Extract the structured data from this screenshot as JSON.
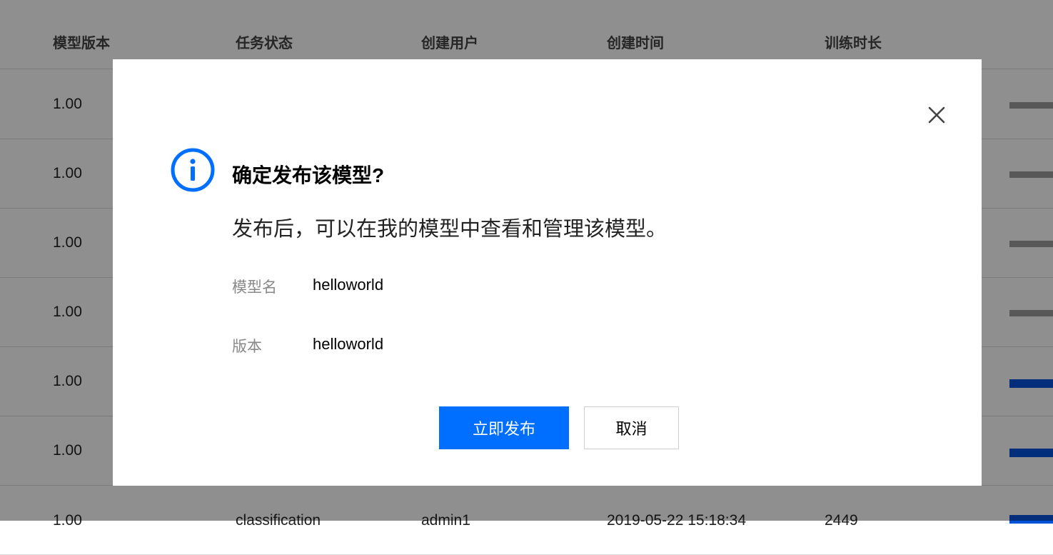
{
  "table": {
    "headers": [
      "模型版本",
      "任务状态",
      "创建用户",
      "创建时间",
      "训练时长"
    ],
    "rows": [
      {
        "version": "1.00",
        "task": "",
        "user": "",
        "time": "",
        "duration": "",
        "bar_status": "inactive"
      },
      {
        "version": "1.00",
        "task": "",
        "user": "",
        "time": "",
        "duration": "",
        "bar_status": "inactive"
      },
      {
        "version": "1.00",
        "task": "",
        "user": "",
        "time": "",
        "duration": "",
        "bar_status": "inactive"
      },
      {
        "version": "1.00",
        "task": "",
        "user": "",
        "time": "",
        "duration": "",
        "bar_status": "inactive"
      },
      {
        "version": "1.00",
        "task": "",
        "user": "",
        "time": "",
        "duration": "",
        "bar_status": "active"
      },
      {
        "version": "1.00",
        "task": "",
        "user": "",
        "time": "",
        "duration": "",
        "bar_status": "active"
      },
      {
        "version": "1.00",
        "task": "classification",
        "user": "admin1",
        "time": "2019-05-22 15:18:34",
        "duration": "2449",
        "bar_status": "active"
      }
    ]
  },
  "dialog": {
    "icon": "info-icon",
    "close_icon": "close-icon",
    "title": "确定发布该模型?",
    "message": "发布后，可以在我的模型中查看和管理该模型。",
    "fields": [
      {
        "label": "模型名",
        "value": "helloworld"
      },
      {
        "label": "版本",
        "value": "helloworld"
      }
    ],
    "confirm_label": "立即发布",
    "cancel_label": "取消"
  },
  "colors": {
    "primary": "#006eff",
    "info": "#006eff",
    "bar_active": "#0052d9",
    "bar_inactive": "#9e9e9e",
    "mask": "rgba(0,0,0,0.44)"
  }
}
